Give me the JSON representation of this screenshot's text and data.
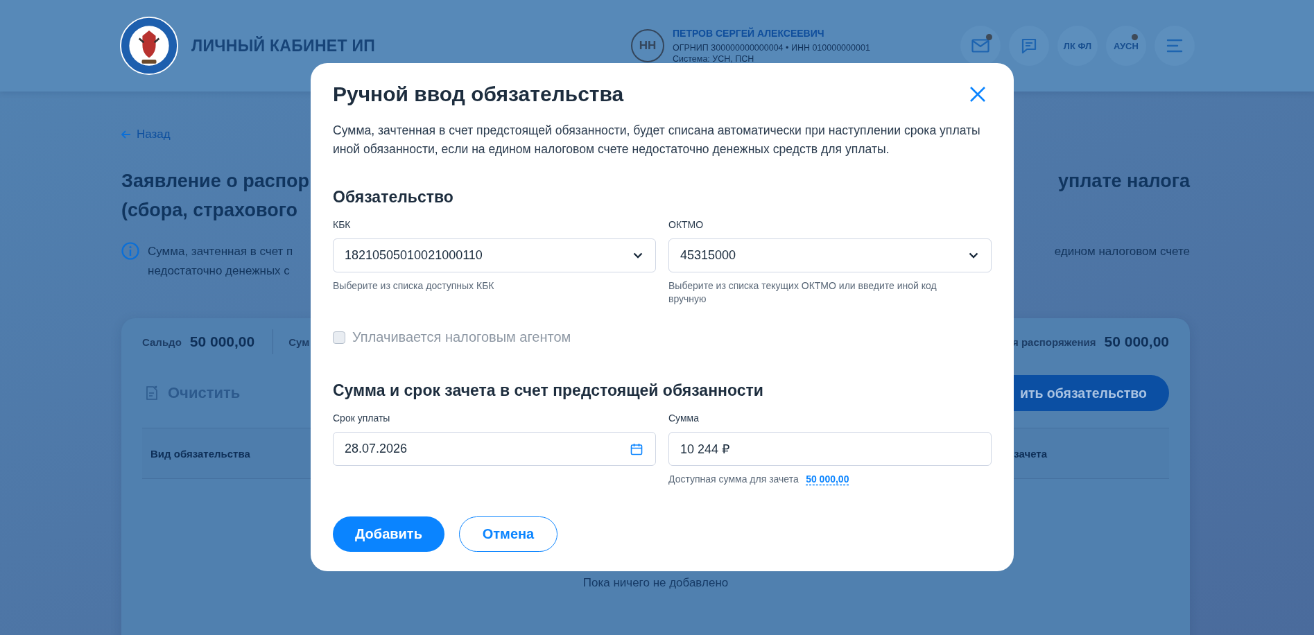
{
  "header": {
    "title": "ЛИЧНЫЙ КАБИНЕТ ИП",
    "avatar_initials": "НН",
    "user_name": "ПЕТРОВ СЕРГЕЙ АЛЕКСЕЕВИЧ",
    "user_ids": "ОГРНИП 300000000000004  •  ИНН 010000000001",
    "user_system": "Система: УСН, ПСН",
    "actions": [
      {
        "kind": "mail",
        "badge": true
      },
      {
        "kind": "chat",
        "badge": false
      },
      {
        "kind": "text",
        "label": "ЛК ФЛ",
        "badge": false
      },
      {
        "kind": "text",
        "label": "АУСН",
        "badge": true
      },
      {
        "kind": "menu",
        "badge": false
      }
    ]
  },
  "page": {
    "back_link": "Назад",
    "title_left": [
      "Заявление о распор",
      "(сбора, страхового"
    ],
    "title_right": "уплате налога",
    "info_left": [
      "Сумма, зачтенная в счет п",
      "недостаточно денежных с"
    ],
    "info_right": "едином налоговом счете",
    "card": {
      "balance": {
        "label": "Сальдо",
        "value": "50 000,00"
      },
      "middle_label": "Сум",
      "disposal": {
        "label": "я распоряжения",
        "value": "50 000,00"
      },
      "clear_button": {
        "label": "Очистить",
        "disabled": true
      },
      "add_button": "ить обязательство",
      "column_left": "Вид обязательства",
      "column_right": "зачета",
      "empty_text": "Пока ничего не добавлено"
    }
  },
  "modal": {
    "title": "Ручной ввод обязательства",
    "description": "Сумма, зачтенная в счет предстоящей обязанности, будет списана автоматически при наступлении срока уплаты иной обязанности, если на едином налоговом счете недостаточно денежных средств для уплаты.",
    "section_1": {
      "title": "Обязательство",
      "fields": [
        {
          "kind": "select",
          "label": "КБК",
          "value": "18210505010021000110",
          "hint": "Выберите из списка доступных КБК"
        },
        {
          "kind": "select",
          "label": "ОКТМО",
          "value": "45315000",
          "hint": "Выберите из списка текущих ОКТМО или введите иной код вручную"
        }
      ]
    },
    "checkbox": {
      "label": "Уплачивается налоговым агентом",
      "checked": false,
      "disabled": true
    },
    "section_2": {
      "title": "Сумма и срок зачета в счет предстоящей обязанности",
      "fields": [
        {
          "kind": "date",
          "label": "Срок уплаты",
          "value": "28.07.2026"
        },
        {
          "kind": "amount",
          "label": "Сумма",
          "value": "10 244 ₽",
          "hint": "Доступная сумма для зачета",
          "hint_link": "50 000,00"
        }
      ]
    },
    "buttons": [
      {
        "kind": "primary",
        "label": "Добавить"
      },
      {
        "kind": "secondary",
        "label": "Отмена"
      }
    ]
  }
}
